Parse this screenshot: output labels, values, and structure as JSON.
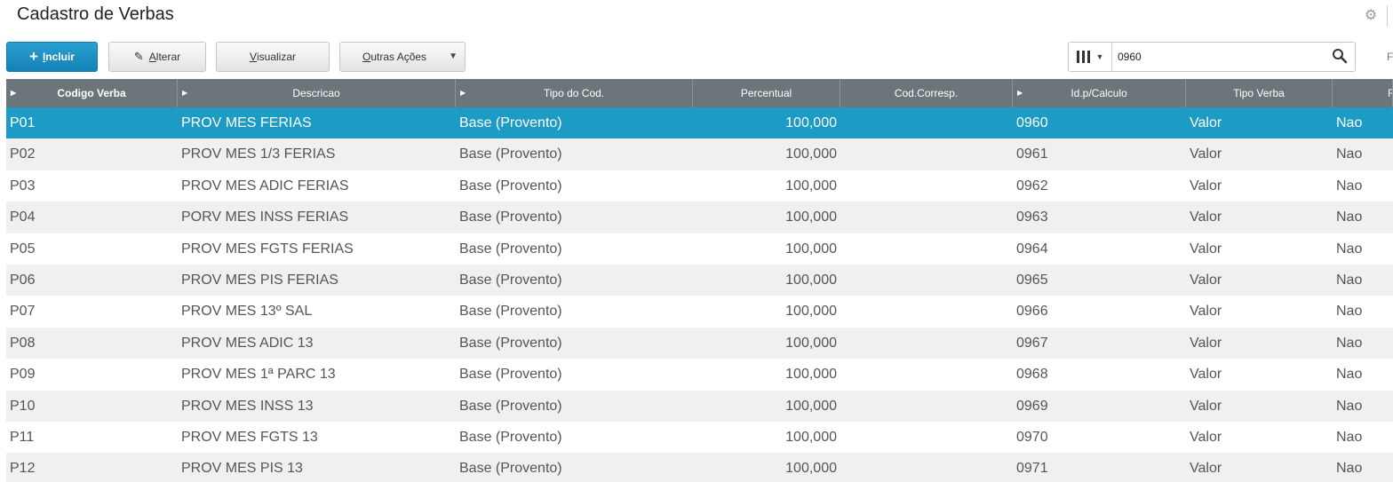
{
  "window": {
    "title": "Cadastro de Verbas"
  },
  "toolbar": {
    "incluir": {
      "rest": "ncluir",
      "key": "I"
    },
    "alterar": {
      "rest": "lterar",
      "key": "A"
    },
    "visualizar": {
      "rest": "isualizar",
      "key": "V"
    },
    "outras": {
      "rest": "utras Ações",
      "key": "O"
    }
  },
  "search": {
    "value": "0960",
    "filter_label": "F"
  },
  "grid": {
    "columns": [
      {
        "label": "Codigo Verba",
        "sortable": true
      },
      {
        "label": "Descricao",
        "sortable": true
      },
      {
        "label": "Tipo do Cod.",
        "sortable": true
      },
      {
        "label": "Percentual",
        "sortable": false
      },
      {
        "label": "Cod.Corresp.",
        "sortable": false
      },
      {
        "label": "Id.p/Calculo",
        "sortable": true
      },
      {
        "label": "Tipo Verba",
        "sortable": false
      },
      {
        "label": "F",
        "sortable": false
      }
    ],
    "rows": [
      [
        "P01",
        "PROV MES FERIAS",
        "Base (Provento)",
        "100,000",
        "0960",
        "Valor",
        "Nao"
      ],
      [
        "P02",
        "PROV MES 1/3 FERIAS",
        "Base (Provento)",
        "100,000",
        "0961",
        "Valor",
        "Nao"
      ],
      [
        "P03",
        "PROV MES ADIC FERIAS",
        "Base (Provento)",
        "100,000",
        "0962",
        "Valor",
        "Nao"
      ],
      [
        "P04",
        "PORV MES INSS FERIAS",
        "Base (Provento)",
        "100,000",
        "0963",
        "Valor",
        "Nao"
      ],
      [
        "P05",
        "PROV MES FGTS FERIAS",
        "Base (Provento)",
        "100,000",
        "0964",
        "Valor",
        "Nao"
      ],
      [
        "P06",
        "PROV MES PIS FERIAS",
        "Base (Provento)",
        "100,000",
        "0965",
        "Valor",
        "Nao"
      ],
      [
        "P07",
        "PROV MES 13º SAL",
        "Base (Provento)",
        "100,000",
        "0966",
        "Valor",
        "Nao"
      ],
      [
        "P08",
        "PROV MES ADIC 13",
        "Base (Provento)",
        "100,000",
        "0967",
        "Valor",
        "Nao"
      ],
      [
        "P09",
        "PROV MES 1ª PARC 13",
        "Base (Provento)",
        "100,000",
        "0968",
        "Valor",
        "Nao"
      ],
      [
        "P10",
        "PROV MES INSS 13",
        "Base (Provento)",
        "100,000",
        "0969",
        "Valor",
        "Nao"
      ],
      [
        "P11",
        "PROV MES FGTS 13",
        "Base (Provento)",
        "100,000",
        "0970",
        "Valor",
        "Nao"
      ],
      [
        "P12",
        "PROV MES PIS 13",
        "Base (Provento)",
        "100,000",
        "0971",
        "Valor",
        "Nao"
      ]
    ],
    "selected_row": 0
  },
  "colors": {
    "primary": "#1a8fc2",
    "header": "#6c757a",
    "selected": "#1c9bc5",
    "row_alt": "#f0f0f0"
  }
}
